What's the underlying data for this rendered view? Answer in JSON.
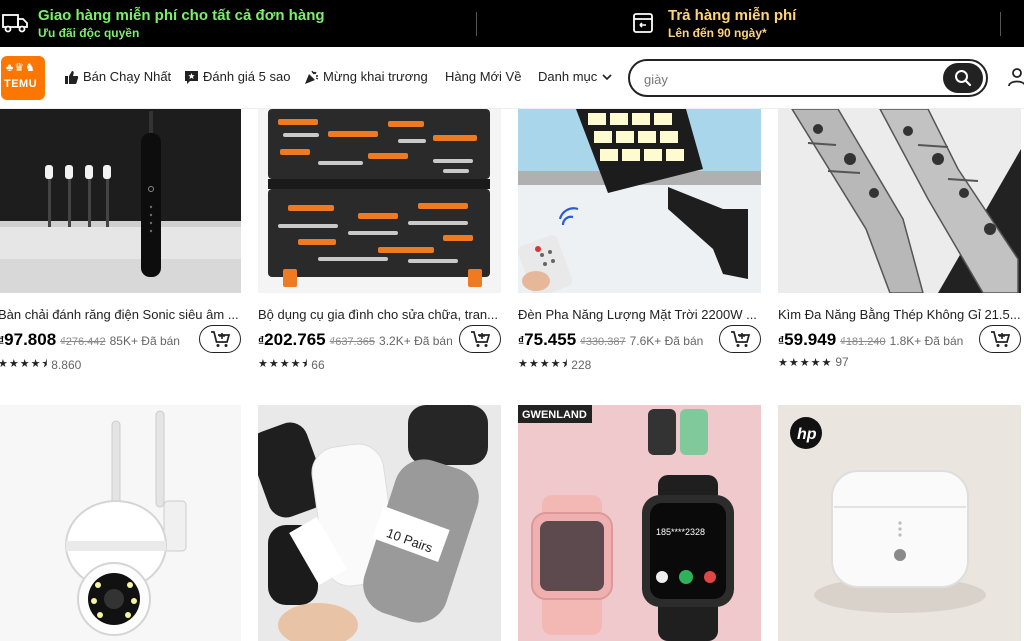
{
  "promo": {
    "shipping_title": "Giao hàng miễn phí cho tất cả đơn hàng",
    "shipping_sub": "Ưu đãi độc quyền",
    "returns_title": "Trả hàng miễn phí",
    "returns_sub": "Lên đến 90 ngày*",
    "colors": {
      "shipping": "#7cf06a",
      "returns": "#ffd37a",
      "background": "#000000"
    }
  },
  "nav": {
    "logo_text": "TEMU",
    "logo_color": "#fb7701",
    "items": [
      {
        "label": "Bán Chạy Nhất",
        "icon": "thumbs-up-icon"
      },
      {
        "label": "Đánh giá 5 sao",
        "icon": "star-chat-icon"
      },
      {
        "label": "Mừng khai trương",
        "icon": "party-popper-icon"
      },
      {
        "label": "Hàng Mới Về",
        "icon": ""
      },
      {
        "label": "Danh mục",
        "icon": "chevron-down-icon"
      }
    ],
    "search_placeholder": "giày",
    "search_icon": "search-icon",
    "user_icon": "user-icon"
  },
  "products": [
    {
      "title": "Bàn chải đánh răng điện Sonic siêu âm ...",
      "currency": "₫",
      "price": "97.808",
      "old_price": "₫276.442",
      "sold": "85K+ Đã bán",
      "rating": 4.5,
      "reviews": "8.860"
    },
    {
      "title": "Bộ dụng cụ gia đình cho sửa chữa, tran...",
      "currency": "₫",
      "price": "202.765",
      "old_price": "₫637.365",
      "sold": "3.2K+ Đã bán",
      "rating": 4.5,
      "reviews": "66"
    },
    {
      "title": "Đèn Pha Năng Lượng Mặt Trời 2200W ...",
      "currency": "₫",
      "price": "75.455",
      "old_price": "₫330.387",
      "sold": "7.6K+ Đã bán",
      "rating": 4.5,
      "reviews": "228"
    },
    {
      "title": "Kìm Đa Năng Bằng Thép Không Gỉ 21.5...",
      "currency": "₫",
      "price": "59.949",
      "old_price": "₫181.240",
      "sold": "1.8K+ Đã bán",
      "rating": 5,
      "reviews": "97"
    },
    {
      "title": "",
      "image_text": "",
      "image_icon": "security-camera-image"
    },
    {
      "title": "",
      "image_text": "10 Pairs",
      "image_icon": "socks-image"
    },
    {
      "title": "",
      "image_text": "GWENLAND",
      "image_icon": "smartwatch-image"
    },
    {
      "title": "",
      "image_text": "hp",
      "image_icon": "earbuds-case-image"
    }
  ],
  "star_glyphs": {
    "full": "★★★★★",
    "half": "★★★★⯨"
  }
}
